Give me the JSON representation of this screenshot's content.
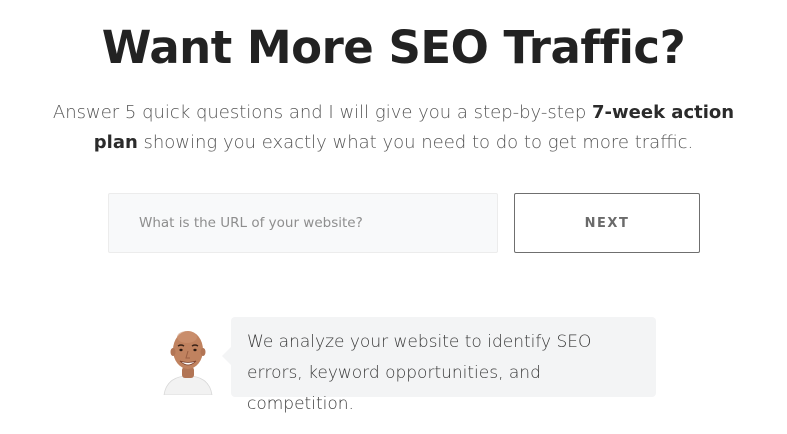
{
  "hero": {
    "title": "Want More SEO Traffic?",
    "subtitle_part1": "Answer 5 quick questions and I will give you a step-by-step ",
    "subtitle_bold": "7-week action plan",
    "subtitle_part2": " showing you exactly what you need to do to get more traffic."
  },
  "form": {
    "url_placeholder": "What is the URL of your website?",
    "url_value": "",
    "next_label": "NEXT"
  },
  "testimonial": {
    "text": "We analyze your website to identify SEO errors, keyword opportunities, and competition."
  },
  "colors": {
    "title": "#222222",
    "input_bg": "#f8f9fa",
    "button_border": "#6f6f6f",
    "bubble_bg": "#f3f4f5"
  }
}
